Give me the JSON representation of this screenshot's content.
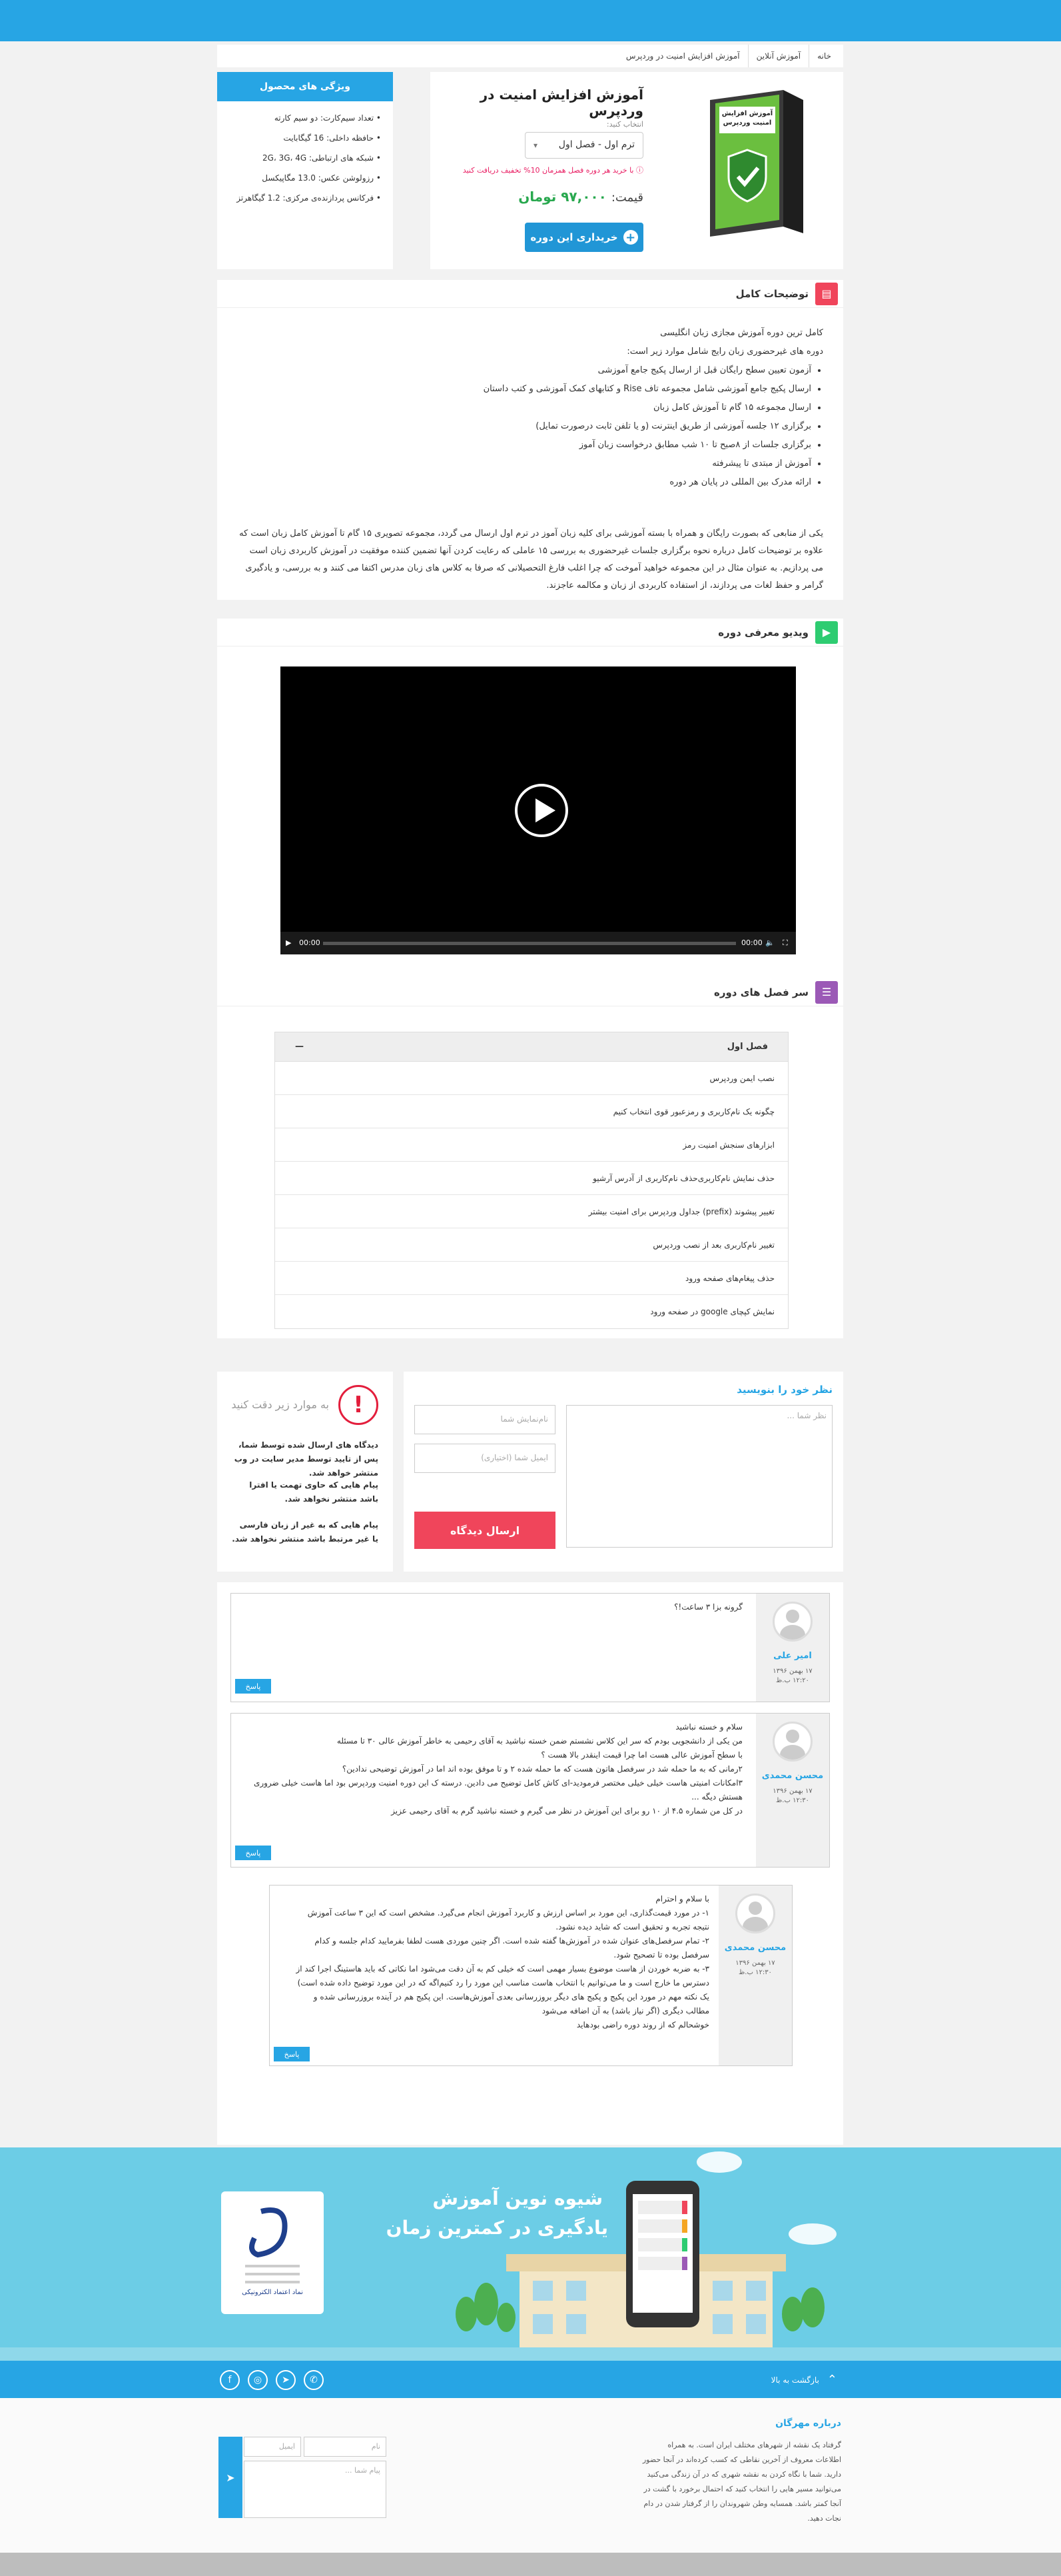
{
  "breadcrumb": [
    "خانه",
    "آموزش آنلاین",
    "آموزش افزایش امنیت در وردپرس"
  ],
  "product": {
    "title": "آموزش افزایش امنیت در وردپرس",
    "box_text": "آموزش افزایش امنیت وردپرس",
    "select_label": "انتخاب کنید:",
    "selected_option": "ترم اول - فصل اول",
    "discount_note": "با خرید هر دوره فصل همزمان 10% تخفیف دریافت کنید",
    "price_label": "قیمت:",
    "price_value": "۹۷,۰۰۰ تومان",
    "buy_label": "خریداری این دوره"
  },
  "features": {
    "title": "ویژگی های محصول",
    "items": [
      "تعداد سیم‌کارت: دو سیم کارته",
      "حافظه داخلی: 16 گیگابایت",
      "شبکه های ارتباطی: 2G، 3G، 4G",
      "رزولوشن عکس: 13.0 مگاپیکسل",
      "فرکانس پردازنده‌ی مرکزی: 1.2 گیگاهرتز"
    ]
  },
  "description": {
    "title": "توضیحات کامل",
    "intro": [
      "کامل ترین دوره آموزش مجازی زبان انگلیسی",
      "دوره های غیرحضوری زبان رایج شامل موارد زیر است:"
    ],
    "bullets": [
      "آزمون تعیین سطح رایگان قبل از ارسال پکیج جامع آموزشی",
      "ارسال پکیج جامع آموزشی شامل مجموعه تاف Rise و کتابهای کمک آموزشی و کتب داستان",
      "ارسال مجموعه ۱۵ گام تا آموزش کامل زبان",
      "برگزاری ۱۲ جلسه آموزشی از طریق اینترنت (و یا تلفن ثابت درصورت تمایل)",
      "برگزاری جلسات از ۸صبح تا ۱۰ شب مطابق درخواست زبان آموز",
      "آموزش از مبتدی تا پیشرفته",
      "ارائه مدرک بین المللی در پایان هر دوره"
    ],
    "paragraph": "یکی از منابعی که بصورت رایگان و همراه با بسته آموزشی برای کلیه زبان آموز در ترم اول ارسال می گردد، مجموعه تصویری ۱۵ گام تا آموزش کامل زبان است که علاوه بر توضیحات کامل درباره نحوه برگزاری جلسات غیرحضوری به بررسی ۱۵ عاملی که رعایت کردن آنها تضمین کننده موفقیت در آموزش کاربردی زبان است می پردازیم. به عنوان مثال در این مجموعه خواهید آموخت که چرا اغلب فارغ التحصیلانی که صرفا به کلاس های زبان مدرس اکتفا می کنند و به بررسی، و یادگیری گرامر و حفظ لغات می پردازند، از استفاده کاربردی از زبان و مکالمه عاجزند."
  },
  "video": {
    "title": "ویدیو معرفی دوره",
    "time_current": "00:00",
    "time_total": "00:00"
  },
  "chapters": {
    "title": "سر فصل های دوره",
    "group": "فصل اول",
    "toggle": "—",
    "items": [
      "نصب ایمن وردپرس",
      "چگونه یک نام‌کاربری و رمزعبور قوی انتخاب کنیم",
      "ابزارهای سنجش امنیت رمز",
      "حذف نمایش نام‌کاربری‌حذف نام‌کاربری از آدرس آرشیو",
      "تغییر پیشوند (prefix) جداول وردپرس برای امنیت بیشتر",
      "تغییر نام‌کاربری بعد از نصب وردپرس",
      "حذف پیغام‌های صفحه ورود",
      "نمایش کپچای google در صفحه ورود"
    ]
  },
  "comment_form": {
    "title": "نظر خود را بنویسید",
    "message_placeholder": "نظر شما ...",
    "name_placeholder": "نام‌نمایش شما",
    "email_placeholder": "ایمیل شما (اختیاری)",
    "submit_label": "ارسال دیدگاه"
  },
  "rules": {
    "icon": "!",
    "title": "به موارد زیر دقت کنید",
    "items": [
      "دیدگاه های ارسال شده توسط شما، پس از تایید توسط مدیر سایت در وب منتشر خواهد شد.",
      "پیام هایی که حاوی تهمت یا افترا باشد منتشر نخواهد شد.",
      "پیام هایی که به غیر از زبان فارسی یا غیر مرتبط باشد منتشر نخواهد شد."
    ]
  },
  "comments": [
    {
      "author": "امیر علی",
      "date": "۱۷ بهمن ۱۳۹۶",
      "time": "۱۲:۲۰ ب.ظ",
      "text": [
        "گرونه بزا ۳ ساعت!؟"
      ],
      "reply": "پاسخ"
    },
    {
      "author": "محسن محمدی",
      "date": "۱۷ بهمن ۱۳۹۶",
      "time": "۱۲:۳۰ ب.ظ",
      "text": [
        "سلام و خسته نباشید",
        "من یکی از دانشجویی بودم که سر این کلاس نشستم ضمن خسته نباشید به آقای رحیمی به خاطر آموزش عالی ۳۰ تا مسئله",
        "با سطح آموزش عالی هست اما چرا قیمت اینقدر بالا هست ؟",
        "۲رمانی که به ما حمله شد در سرفصل هاتون هست که ما حمله شده ۲ و تا موفق بوده اند اما در آموزش توضیحی ندادین؟",
        "۳امکانات امنیتی هاست خیلی خیلی مختصر فرمودید-ای کاش کامل توضیح می دادین. درسته ک این دوره امنیت وردپرس بود اما هاست خیلی ضروری هستش دیگه ...",
        "در کل من شماره ۴.۵ از ۱۰ رو برای این آموزش در نظر می گیرم و خسته نباشید گرم به آقای رحیمی عزیز"
      ],
      "reply": "پاسخ"
    },
    {
      "author": "محسن محمدی",
      "date": "۱۷ بهمن ۱۳۹۶",
      "time": "۱۲:۳۰ ب.ظ",
      "text": [
        "با سلام و احترام",
        "۱- در مورد قیمت‌گذاری، این مورد بر اساس ارزش و کاربرد آموزش انجام می‌گیرد. مشخص است که این ۳ ساعت آموزش نتیجه تجربه و تحقیق است که شاید دیده نشود.",
        "۲- تمام سرفصل‌های عنوان شده در آموزش‌ها گفته شده است. اگر چنین موردی هست لطفا بفرمایید کدام جلسه و کدام سرفصل بوده تا تصحیح شود.",
        "۳- به ضربه خوردن از هاست موضوع بسیار مهمی است که خیلی کم به آن دقت می‌شود اما نکاتی که باید هاستینگ اجرا کند از دسترس ما خارج است و ما می‌توانیم با انتخاب هاست مناسب این مورد را رد کنیم‌اگه که در این مورد توضیح داده شده است)",
        "یک نکته مهم در مورد این پکیج و پکیج های دیگر بروزرسانی بعدی آموزش‌هاست. این پکیج هم در آینده بروزرسانی شده و مطالب دیگری (اگر نیاز باشد) به آن اضافه می‌شود",
        "خوشحالم که از روند دوره راضی بودهاید"
      ],
      "reply": "پاسخ"
    }
  ],
  "hero": {
    "line1": "شیوه نوین آموزش",
    "line2": "یادگیری در کمترین زمان"
  },
  "footer": {
    "to_top": "بازگشت به بالا",
    "about_title": "درباره مهرگان",
    "about_text": "گرفتاد یک نقشه از شهرهای مختلف ایران است. به همراه اطلاعات معروف از آخرین نقاطی که کسب کرده‌اند در آنجا حضور دارید. شما با نگاه کردن به نقشه شهری که در آن زندگی می‌کنید می‌توانید مسیر هایی را انتخاب کنید که احتمال برخورد با گشت در آنجا کمتر باشد. همسایه وطن شهروندان را از گرفتار شدن در دام نجات دهید.",
    "name_placeholder": "نام",
    "email_placeholder": "ایمیل",
    "message_placeholder": "پیام شما ...",
    "enamad_text": "نماد اعتماد الکترونیکی"
  },
  "colors": {
    "primary": "#27a5e4",
    "accent_red": "#f0455b",
    "price_green": "#29a84f",
    "hero_bg": "#6ccde6"
  }
}
